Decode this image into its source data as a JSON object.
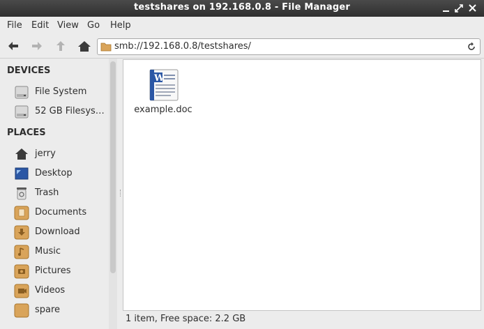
{
  "window": {
    "title": "testshares on 192.168.0.8 - File Manager"
  },
  "menu": [
    "File",
    "Edit",
    "View",
    "Go",
    "Help"
  ],
  "toolbar": {
    "buttons": [
      "back-arrow-icon",
      "forward-arrow-icon",
      "up-arrow-icon",
      "home-icon"
    ],
    "location": "smb://192.168.0.8/testshares/"
  },
  "sidebar": {
    "devices_title": "DEVICES",
    "devices": [
      {
        "label": "File System",
        "icon": "drive-icon"
      },
      {
        "label": "52 GB Filesys…",
        "icon": "drive-icon"
      }
    ],
    "places_title": "PLACES",
    "places": [
      {
        "label": "jerry",
        "icon": "home-icon"
      },
      {
        "label": "Desktop",
        "icon": "desktop-icon"
      },
      {
        "label": "Trash",
        "icon": "trash-icon"
      },
      {
        "label": "Documents",
        "icon": "documents-folder-icon"
      },
      {
        "label": "Download",
        "icon": "download-folder-icon"
      },
      {
        "label": "Music",
        "icon": "music-folder-icon"
      },
      {
        "label": "Pictures",
        "icon": "pictures-folder-icon"
      },
      {
        "label": "Videos",
        "icon": "videos-folder-icon"
      },
      {
        "label": "spare",
        "icon": "folder-icon"
      }
    ]
  },
  "files": [
    {
      "name": "example.doc",
      "icon": "word-document-icon"
    }
  ],
  "status": "1 item, Free space: 2.2 GB",
  "colors": {
    "titlebar": "#3a3a3a",
    "folder": "#d9a45a",
    "doc_blue": "#2b57a5"
  }
}
